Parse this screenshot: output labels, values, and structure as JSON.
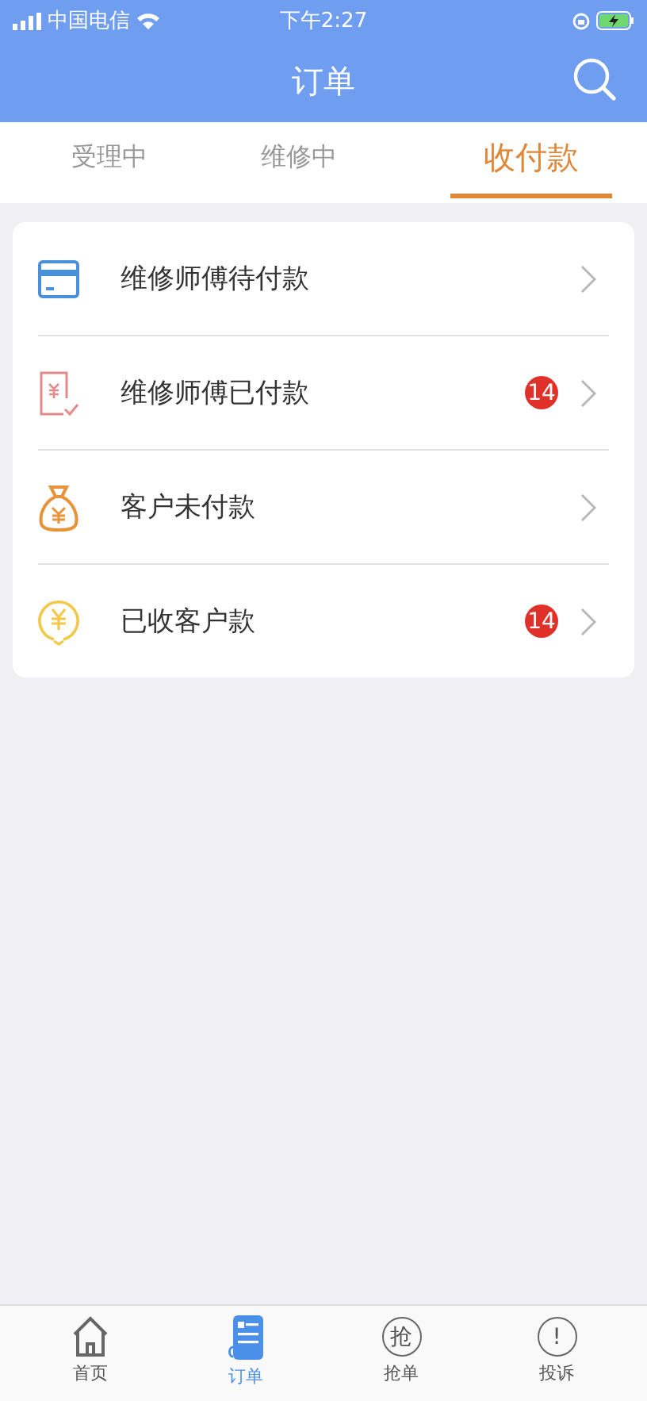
{
  "status_bar": {
    "carrier": "中国电信",
    "time": "下午2:27"
  },
  "header": {
    "title": "订单"
  },
  "tabs": [
    {
      "label": "受理中",
      "selected": false
    },
    {
      "label": "维修中",
      "selected": false
    },
    {
      "label": "收付款",
      "selected": true
    }
  ],
  "items": [
    {
      "kind": "card",
      "label": "维修师傅待付款"
    },
    {
      "kind": "receipt",
      "label": "维修师傅已付款",
      "badge": "14"
    },
    {
      "kind": "bag",
      "label": "客户未付款"
    },
    {
      "kind": "coin",
      "label": "已收客户款",
      "badge": "14"
    }
  ],
  "tab_bar": [
    {
      "kind": "home",
      "label": "首页",
      "selected": false
    },
    {
      "kind": "order",
      "label": "订单",
      "selected": true
    },
    {
      "kind": "grab",
      "glyph": "抢",
      "label": "抢单",
      "selected": false
    },
    {
      "kind": "alert",
      "glyph": "!",
      "label": "投诉",
      "selected": false
    }
  ]
}
